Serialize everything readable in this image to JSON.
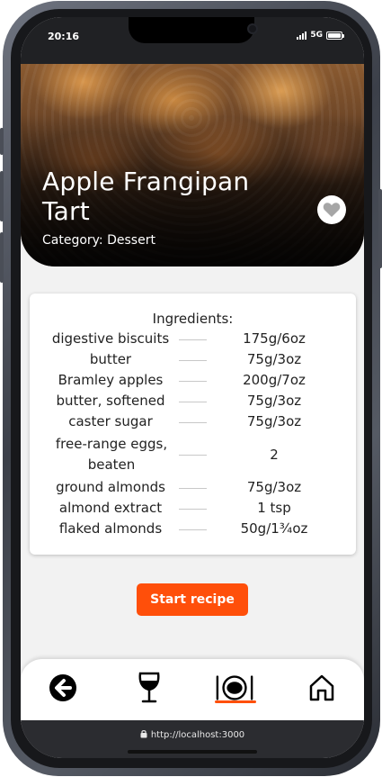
{
  "status_bar": {
    "time": "20:16",
    "network": "5G"
  },
  "recipe": {
    "title": "Apple Frangipan Tart",
    "category": "Category: Dessert"
  },
  "ingredients": {
    "heading": "Ingredients:",
    "items": [
      {
        "name": "digestive biscuits",
        "qty": "175g/6oz"
      },
      {
        "name": "butter",
        "qty": "75g/3oz"
      },
      {
        "name": "Bramley apples",
        "qty": "200g/7oz"
      },
      {
        "name": "butter, softened",
        "qty": "75g/3oz"
      },
      {
        "name": "caster sugar",
        "qty": "75g/3oz"
      },
      {
        "name": "free-range eggs, beaten",
        "qty": "2"
      },
      {
        "name": "ground almonds",
        "qty": "75g/3oz"
      },
      {
        "name": "almond extract",
        "qty": "1 tsp"
      },
      {
        "name": "flaked almonds",
        "qty": "50g/1¾oz"
      }
    ]
  },
  "actions": {
    "start_label": "Start recipe"
  },
  "bottom_nav": {
    "items": [
      "back-arrow-icon",
      "wine-glass-icon",
      "plate-cutlery-icon",
      "home-icon"
    ],
    "active": "plate-cutlery-icon"
  },
  "browser": {
    "url": "http://localhost:3000"
  },
  "colors": {
    "accent": "#ff4f0a",
    "status_bar": "#202124",
    "browser_bar": "#2b2c30",
    "page_bg": "#f2f2f2"
  }
}
